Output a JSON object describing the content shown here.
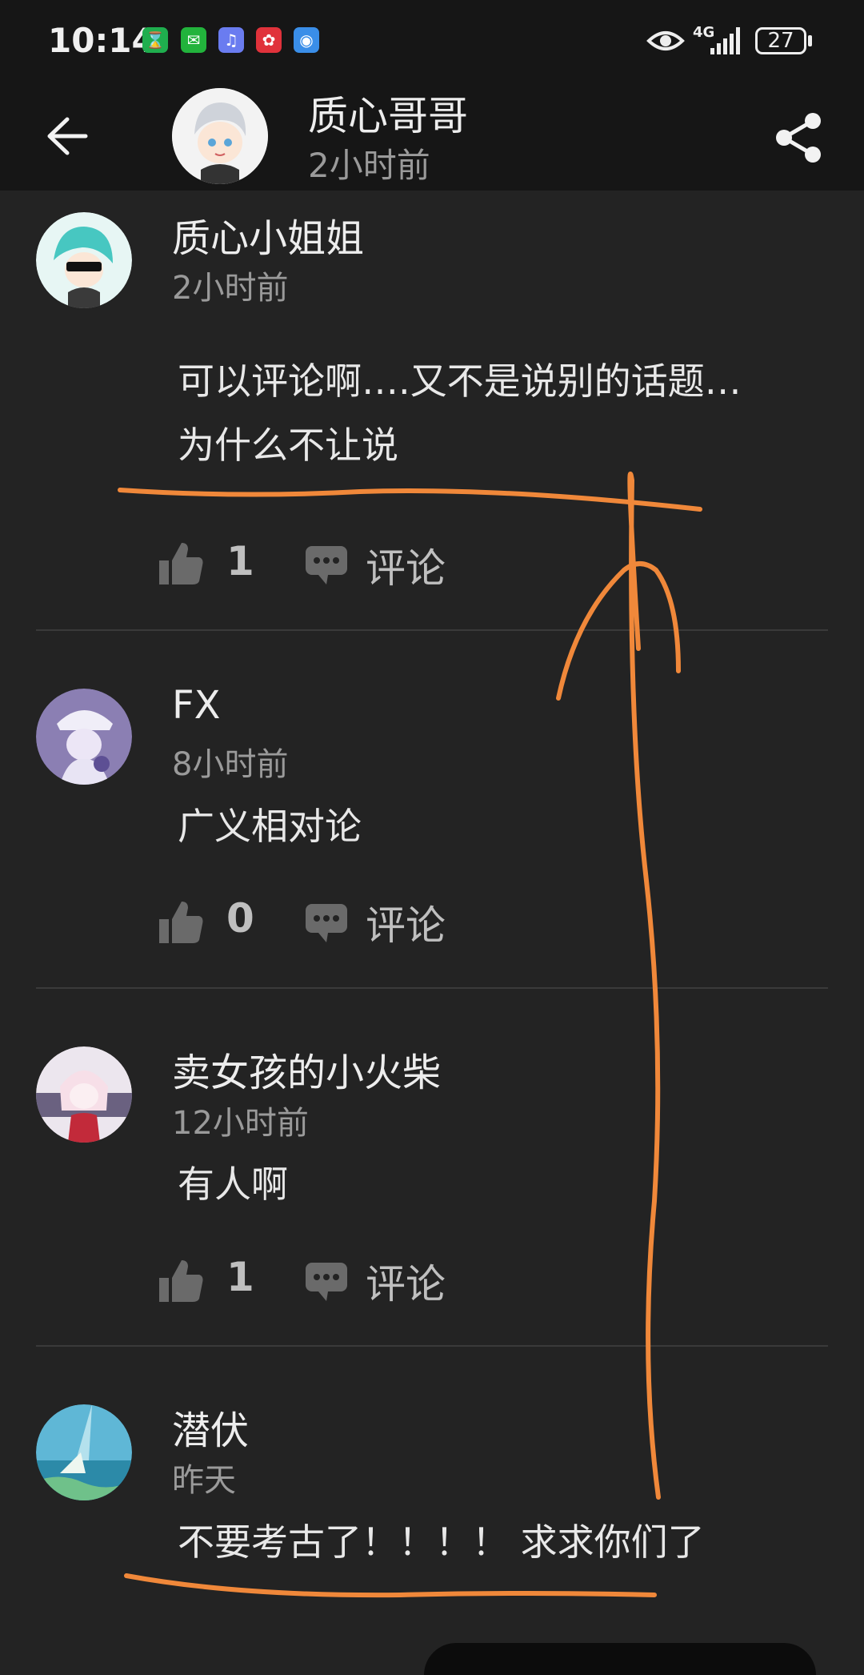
{
  "status_bar": {
    "time": "10:14",
    "network": "4G",
    "battery": "27",
    "icons": [
      "hourglass-icon",
      "wechat-icon",
      "music-icon",
      "huawei-icon",
      "browser-icon",
      "eye-icon",
      "signal-icon",
      "battery-icon"
    ]
  },
  "header": {
    "back_icon": "back-arrow-icon",
    "author": "质心哥哥",
    "time": "2小时前",
    "share_icon": "share-icon"
  },
  "comments": [
    {
      "user": "质心小姐姐",
      "time": "2小时前",
      "lines": [
        "可以评论啊….又不是说别的话题…",
        "为什么不让说"
      ],
      "likes": "1",
      "comment_label": "评论"
    },
    {
      "user": "FX",
      "time": "8小时前",
      "lines": [
        "广义相对论"
      ],
      "likes": "0",
      "comment_label": "评论"
    },
    {
      "user": "卖女孩的小火柴",
      "time": "12小时前",
      "lines": [
        "有人啊"
      ],
      "likes": "1",
      "comment_label": "评论"
    },
    {
      "user": "潜伏",
      "time": "昨天",
      "lines": [
        "不要考古了！！！！ 求求你们了"
      ]
    }
  ],
  "colors": {
    "background": "#232323",
    "bar": "#161616",
    "annotation": "#f0883a"
  }
}
